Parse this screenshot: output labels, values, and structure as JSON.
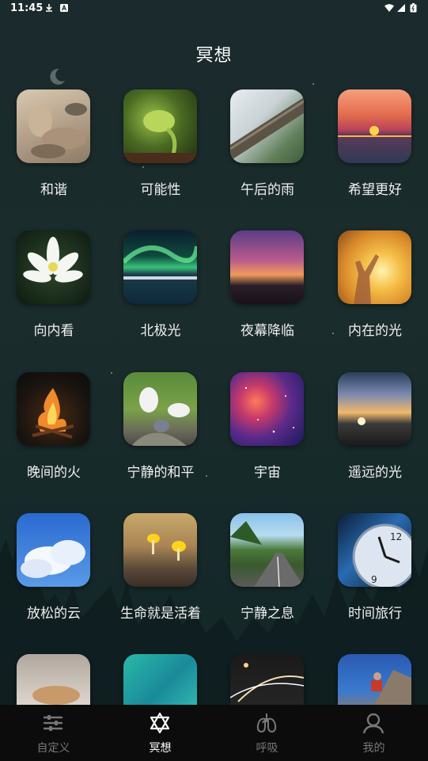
{
  "status_bar": {
    "time": "11:45"
  },
  "page": {
    "title": "冥想"
  },
  "tiles": [
    {
      "label": "和谐",
      "icon": "stones-image"
    },
    {
      "label": "可能性",
      "icon": "sprout-image"
    },
    {
      "label": "午后的雨",
      "icon": "rainy-roof-image"
    },
    {
      "label": "希望更好",
      "icon": "sunset-sea-image"
    },
    {
      "label": "向内看",
      "icon": "lotus-image"
    },
    {
      "label": "北极光",
      "icon": "aurora-image"
    },
    {
      "label": "夜幕降临",
      "icon": "dusk-sky-image"
    },
    {
      "label": "内在的光",
      "icon": "sunlight-person-image"
    },
    {
      "label": "晚间的火",
      "icon": "campfire-image"
    },
    {
      "label": "宁静的和平",
      "icon": "doves-image"
    },
    {
      "label": "宇宙",
      "icon": "nebula-image"
    },
    {
      "label": "遥远的光",
      "icon": "horizon-sun-image"
    },
    {
      "label": "放松的云",
      "icon": "clouds-image"
    },
    {
      "label": "生命就是活着",
      "icon": "mushrooms-image"
    },
    {
      "label": "宁静之息",
      "icon": "road-trees-image"
    },
    {
      "label": "时间旅行",
      "icon": "clock-image"
    },
    {
      "label": "",
      "icon": "sleeping-cat-image"
    },
    {
      "label": "",
      "icon": "water-image"
    },
    {
      "label": "",
      "icon": "night-road-image"
    },
    {
      "label": "",
      "icon": "climber-image"
    }
  ],
  "nav": {
    "items": [
      {
        "label": "自定义",
        "icon": "sliders-icon"
      },
      {
        "label": "冥想",
        "icon": "star-of-david-icon"
      },
      {
        "label": "呼吸",
        "icon": "lungs-icon"
      },
      {
        "label": "我的",
        "icon": "user-icon"
      }
    ],
    "active_index": 1
  },
  "colors": {
    "background": "#1a2c2b",
    "nav_background": "#0c0c0c",
    "nav_active": "#ffffff",
    "nav_inactive": "#777777"
  }
}
